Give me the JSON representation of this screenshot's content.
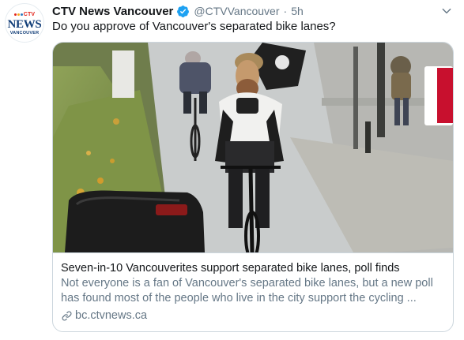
{
  "tweet": {
    "display_name": "CTV News Vancouver",
    "verified_icon": "verified-badge-icon",
    "handle": "@CTVVancouver",
    "separator": "·",
    "time": "5h",
    "text": "Do you approve of Vancouver's separated bike lanes?",
    "menu_icon": "chevron-down-icon"
  },
  "avatar": {
    "brand_top": "CTV",
    "brand_main": "NEWS",
    "brand_sub": "VANCOUVER"
  },
  "card": {
    "image_description_icon": "photo",
    "title": "Seven-in-10 Vancouverites support separated bike lanes, poll finds",
    "description_line1": "Not everyone is a fan of Vancouver's separated bike lanes, but a new poll",
    "description_line2": "has found most of the people who live in the city support the cycling ...",
    "domain": "bc.ctvnews.ca",
    "domain_icon": "link-icon"
  },
  "colors": {
    "verified_blue": "#1da1f2",
    "secondary_text": "#657786",
    "border": "#ccd6dd",
    "ctv_red": "#e2231a",
    "ctv_navy": "#123e78"
  }
}
